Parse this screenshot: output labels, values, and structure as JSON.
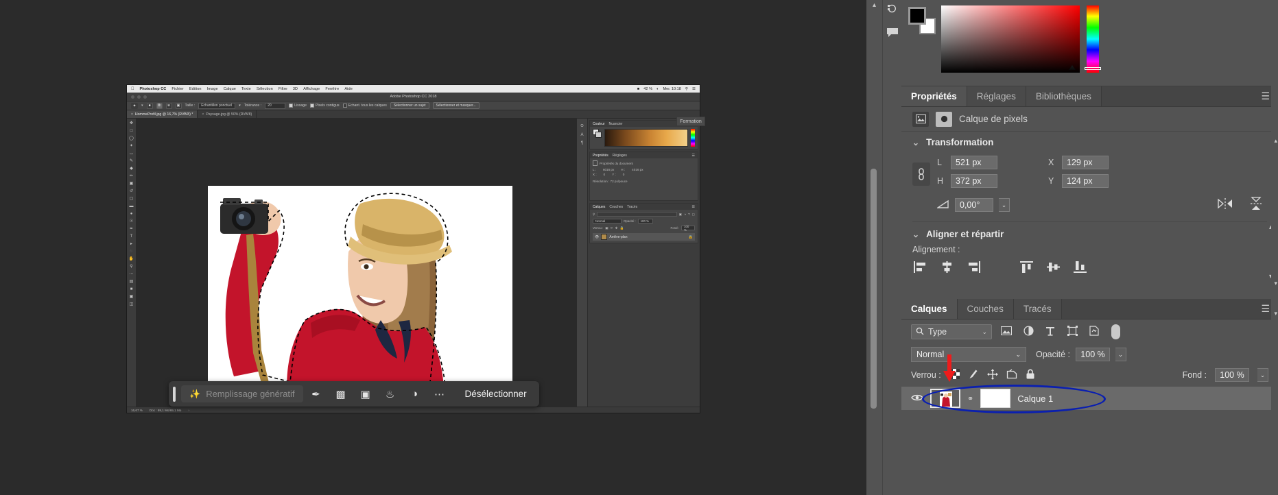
{
  "outer_app": {
    "right_rail_icons": [
      "history-icon",
      "comment-icon"
    ],
    "color_panel": {
      "name": "color-picker-panel",
      "foreground_color": "#000000",
      "background_color": "#ffffff"
    },
    "properties_panel": {
      "tabs": [
        {
          "label": "Propriétés",
          "active": true
        },
        {
          "label": "Réglages",
          "active": false
        },
        {
          "label": "Bibliothèques",
          "active": false
        }
      ],
      "menu_icon": "hamburger-icon",
      "layer_kind_label": "Calque de pixels",
      "layer_kind_icons": [
        "image-thumbnail-icon",
        "mask-circle-icon"
      ],
      "sections": [
        {
          "title": "Transformation",
          "fields": [
            {
              "label": "L",
              "value": "521 px"
            },
            {
              "label": "H",
              "value": "372 px"
            },
            {
              "label": "X",
              "value": "129 px"
            },
            {
              "label": "Y",
              "value": "124 px"
            }
          ],
          "angle_label": "angle-icon",
          "angle_value": "0,00°",
          "flip_icons": [
            "flip-horizontal-icon",
            "flip-vertical-icon"
          ],
          "link_icon": "link-chain-icon"
        },
        {
          "title": "Aligner et répartir",
          "sub_label": "Alignement :",
          "icons": [
            "align-left-icon",
            "align-center-horizontal-icon",
            "align-right-icon",
            "align-top-icon",
            "align-middle-vertical-icon",
            "align-bottom-icon"
          ]
        }
      ]
    },
    "layers_panel": {
      "tabs": [
        {
          "label": "Calques",
          "active": true
        },
        {
          "label": "Couches",
          "active": false
        },
        {
          "label": "Tracés",
          "active": false
        }
      ],
      "menu_icon": "hamburger-icon",
      "filter": {
        "icon": "search-icon",
        "value": "Type",
        "caret": "chevron-down-icon"
      },
      "filter_type_icons": [
        "pixel-filter-icon",
        "adjustment-filter-icon",
        "type-filter-icon",
        "shape-filter-icon",
        "smartobject-filter-icon"
      ],
      "filter_toggle": "filter-enable-toggle",
      "blend_mode": "Normal",
      "blend_caret": "chevron-down-icon",
      "opacity_label": "Opacité :",
      "opacity_value": "100 %",
      "opacity_caret": "chevron-down-icon",
      "lock_label": "Verrou :",
      "lock_icons": [
        "lock-transparent-pixels-icon",
        "lock-image-pixels-icon",
        "lock-position-icon",
        "lock-artboard-nesting-icon",
        "lock-all-icon"
      ],
      "fill_label": "Fond :",
      "fill_value": "100 %",
      "fill_caret": "chevron-down-icon",
      "layers": [
        {
          "visibility_icon": "eye-icon",
          "thumbnail": "layer-thumbnail",
          "link_icon": "mask-link-icon",
          "mask_thumbnail": "layer-mask-thumbnail",
          "name": "Calque 1",
          "selected": true
        }
      ]
    },
    "annotations": {
      "arrow": {
        "name": "red-arrow-annotation",
        "color": "#ee1c1c"
      },
      "ellipse": {
        "name": "blue-ellipse-annotation",
        "color": "#0a1fb0"
      }
    }
  },
  "inner_screenshot": {
    "menubar": {
      "apple_icon": "apple-logo-icon",
      "app_name": "Photoshop CC",
      "items": [
        "Fichier",
        "Edition",
        "Image",
        "Calque",
        "Texte",
        "Sélection",
        "Filtre",
        "3D",
        "Affichage",
        "Fenêtre",
        "Aide"
      ],
      "status_items": [
        "42 %",
        "Mer. 10:18"
      ],
      "status_icons": [
        "battery-icon",
        "wifi-icon",
        "search-icon",
        "menu-icon"
      ]
    },
    "window_title": "Adobe Photoshop CC 2018",
    "options_bar": {
      "tool_icon": "magic-wand-icon",
      "tool_caret": "chevron-down-icon",
      "selection_mode_icons": [
        "new-selection-icon",
        "add-to-selection-icon",
        "subtract-from-selection-icon",
        "intersect-selection-icon"
      ],
      "size_label": "Taille :",
      "size_value": "Echantillon ponctuel",
      "size_caret": "chevron-down-icon",
      "tolerance_label": "Tolérance :",
      "tolerance_value": "20",
      "checkboxes": [
        {
          "label": "Lissage",
          "checked": true
        },
        {
          "label": "Pixels contigus",
          "checked": true
        },
        {
          "label": "Echant. tous les calques",
          "checked": false
        }
      ],
      "buttons": [
        "Sélectionner un sujet",
        "Sélectionner et masquer..."
      ]
    },
    "document_tabs": [
      {
        "close_icon": "close-icon",
        "label": "HommeProfil.jpg @ 16,7% (RVB/8) *",
        "active": true
      },
      {
        "close_icon": "close-icon",
        "label": "Paysage.jpg @ 50% (RVB/8)",
        "active": false
      }
    ],
    "toolbar_icons": [
      "move-tool-icon",
      "marquee-tool-icon",
      "lasso-tool-icon",
      "quick-selection-tool-icon",
      "crop-tool-icon",
      "eyedropper-tool-icon",
      "healing-brush-tool-icon",
      "brush-tool-icon",
      "clone-stamp-tool-icon",
      "history-brush-tool-icon",
      "eraser-tool-icon",
      "gradient-tool-icon",
      "blur-tool-icon",
      "dodge-tool-icon",
      "pen-tool-icon",
      "type-tool-icon",
      "path-selection-tool-icon",
      "shape-tool-icon",
      "hand-tool-icon",
      "zoom-tool-icon",
      "more-tools-icon",
      "default-colors-icon",
      "foreground-background-swatch",
      "quick-mask-icon",
      "screen-mode-icon"
    ],
    "dock_rail_icons": [
      "history-panel-icon",
      "character-panel-icon",
      "paragraph-panel-icon"
    ],
    "panels": {
      "color": {
        "tabs": [
          "Couleur",
          "Nuancier"
        ],
        "menu_icon": "hamburger-icon"
      },
      "properties": {
        "tabs": [
          "Propriétés",
          "Réglages"
        ],
        "menu_icon": "hamburger-icon",
        "heading": "Propriétés du document",
        "fields": [
          {
            "label": "L :",
            "value": "6016 px"
          },
          {
            "label": "H :",
            "value": "4016 px"
          },
          {
            "label": "X :",
            "value": "0"
          },
          {
            "label": "Y :",
            "value": "0"
          }
        ],
        "resolution": "Résolution : 72 px/pouce"
      },
      "layers": {
        "tabs": [
          "Calques",
          "Couches",
          "Tracés"
        ],
        "menu_icon": "hamburger-icon",
        "filter_value": "Type",
        "blend_mode": "Normal",
        "opacity_label": "Opacité :",
        "opacity_value": "100 %",
        "lock_label": "Verrou :",
        "fill_label": "Fond :",
        "fill_value": "100 %",
        "rows": [
          {
            "visibility_icon": "eye-icon",
            "name": "Arrière-plan",
            "lock_icon": "lock-icon"
          }
        ]
      },
      "right_side_icons": [
        "collapse-icon"
      ]
    },
    "status_bar": {
      "zoom": "16,67 %",
      "doc_info": "Doc : 69,1 Mo/69,1 Mo",
      "caret": "chevron-right-icon"
    },
    "formation_tab": "Formation",
    "contextual_task_bar": {
      "grip": "drag-grip",
      "generative_fill_icon": "generative-fill-sparkle-icon",
      "generative_fill_label": "Remplissage génératif",
      "icons": [
        "select-subject-icon",
        "select-and-mask-icon",
        "invert-selection-icon",
        "fill-selection-icon",
        "adjustment-layer-icon",
        "more-options-icon"
      ],
      "deselect_label": "Désélectionner"
    }
  }
}
